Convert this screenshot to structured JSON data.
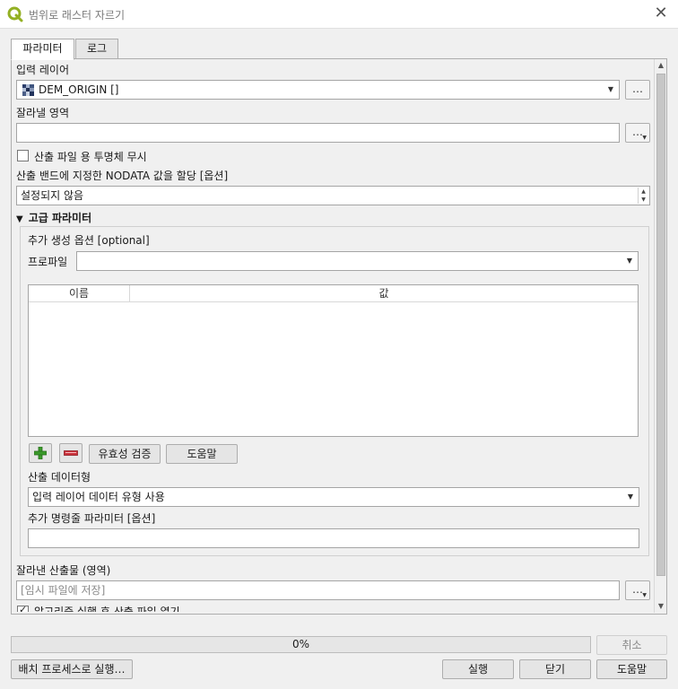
{
  "window": {
    "title": "범위로 래스터 자르기",
    "close_label": "✕",
    "app_icon": "qgis-icon"
  },
  "tabs": [
    {
      "label": "파라미터",
      "active": true
    },
    {
      "label": "로그",
      "active": false
    }
  ],
  "params": {
    "input_layer_label": "입력 레이어",
    "input_layer_value": "DEM_ORIGIN []",
    "input_layer_icon": "raster-layer-icon",
    "extent_label": "잘라낼 영역",
    "extent_value": "",
    "ignore_transparency_label": "산출 파일 용 투명체 무시",
    "ignore_transparency_checked": false,
    "nodata_label": "산출 밴드에 지정한 NODATA 값을 할당 [옵션]",
    "nodata_value": "설정되지 않음",
    "advanced_label": "고급 파라미터",
    "extra_options_label": "추가 생성 옵션 [optional]",
    "profile_label": "프로파일",
    "profile_value": "",
    "table_headers": [
      "이름",
      "값"
    ],
    "add_icon": "plus-icon",
    "remove_icon": "minus-icon",
    "validate_label": "유효성 검증",
    "help_small_label": "도움말",
    "output_datatype_label": "산출 데이터형",
    "output_datatype_value": "입력 레이어 데이터 유형 사용",
    "extra_cmd_label": "추가 명령줄 파라미터 [옵션]",
    "extra_cmd_value": "",
    "clipped_label": "잘라낸 산출물 (영역)",
    "clipped_placeholder": "[임시 파일에 저장]",
    "open_after_label": "알고리즘 실행 후 산출 파일 열기",
    "open_after_checked": true,
    "ellipsis": "…"
  },
  "progress": {
    "text": "0%",
    "value": 0
  },
  "buttons": {
    "cancel": "취소",
    "batch": "배치 프로세스로 실행…",
    "run": "실행",
    "close": "닫기",
    "help": "도움말"
  },
  "colors": {
    "qgis_green": "#93b023",
    "add_green": "#3a9a2a",
    "remove_red": "#c9303a"
  }
}
